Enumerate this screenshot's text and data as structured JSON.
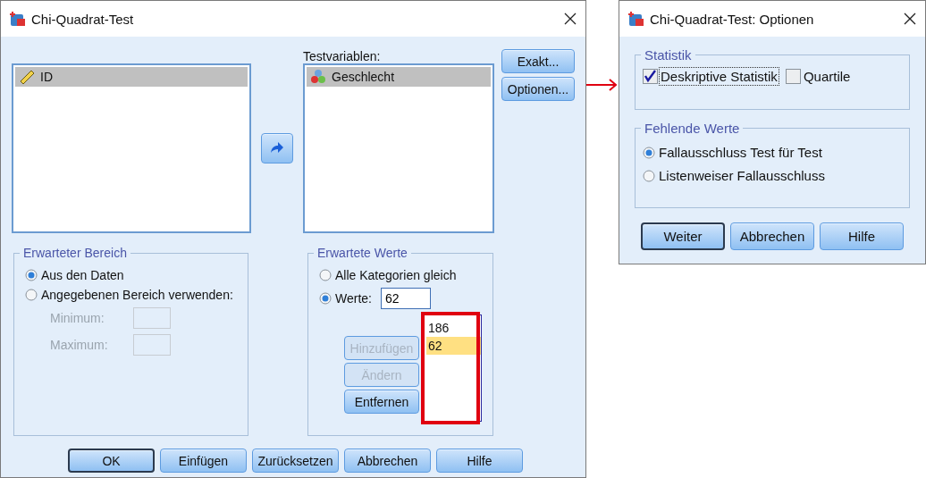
{
  "main_dialog": {
    "title": "Chi-Quadrat-Test",
    "source_list": {
      "items": [
        {
          "label": "ID",
          "kind": "scale",
          "selected": true
        }
      ]
    },
    "test_variables": {
      "label": "Testvariablen:",
      "items": [
        {
          "label": "Geschlecht",
          "kind": "nominal",
          "selected": true
        }
      ]
    },
    "side_buttons": [
      "Exakt...",
      "Optionen..."
    ],
    "expected_range": {
      "title": "Erwarteter Bereich",
      "options": [
        {
          "label": "Aus den Daten",
          "selected": true
        },
        {
          "label": "Angegebenen Bereich verwenden:",
          "selected": false
        }
      ],
      "fields": [
        {
          "label": "Minimum:",
          "disabled": true
        },
        {
          "label": "Maximum:",
          "disabled": true
        }
      ]
    },
    "expected_values": {
      "title": "Erwartete Werte",
      "options": [
        {
          "label": "Alle Kategorien gleich",
          "selected": false
        },
        {
          "label": "Werte:",
          "selected": true
        }
      ],
      "value": "62",
      "buttons": [
        {
          "label": "Hinzufügen",
          "disabled": true
        },
        {
          "label": "Ändern",
          "disabled": true
        },
        {
          "label": "Entfernen",
          "disabled": false
        }
      ],
      "values_list": [
        {
          "label": "186",
          "selected": false
        },
        {
          "label": "62",
          "selected": true
        }
      ],
      "highlighted": true
    },
    "buttons": [
      {
        "label": "OK",
        "default": true
      },
      {
        "label": "Einfügen",
        "default": false
      },
      {
        "label": "Zurücksetzen",
        "default": false
      },
      {
        "label": "Abbrechen",
        "default": false
      },
      {
        "label": "Hilfe",
        "default": false
      }
    ]
  },
  "options_dialog": {
    "title": "Chi-Quadrat-Test: Optionen",
    "statistics": {
      "title": "Statistik",
      "checkboxes": [
        {
          "label": "Deskriptive Statistik",
          "checked": true,
          "focused": true
        },
        {
          "label": "Quartile",
          "checked": false,
          "focused": false
        }
      ]
    },
    "missing_values": {
      "title": "Fehlende Werte",
      "options": [
        {
          "label": "Fallausschluss Test für Test",
          "selected": true
        },
        {
          "label": "Listenweiser Fallausschluss",
          "selected": false
        }
      ]
    },
    "buttons": [
      {
        "label": "Weiter",
        "default": true
      },
      {
        "label": "Abbrechen",
        "default": false
      },
      {
        "label": "Hilfe",
        "default": false
      }
    ]
  }
}
